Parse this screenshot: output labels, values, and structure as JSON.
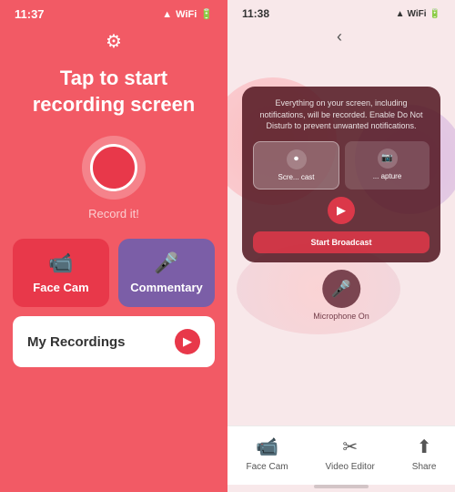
{
  "leftPanel": {
    "statusBar": {
      "time": "11:37",
      "icons": "▲ WiFi 🔋"
    },
    "settingsIcon": "⚙",
    "title": "Tap to start\nrecording screen",
    "recordLabel": "Record it!",
    "faceCamButton": {
      "label": "Face Cam",
      "icon": "📹"
    },
    "commentaryButton": {
      "label": "Commentary",
      "icon": "🎤"
    },
    "recordingsBar": {
      "label": "My Recordings",
      "arrowIcon": "▶"
    }
  },
  "rightPanel": {
    "statusBar": {
      "time": "11:38",
      "icons": "▲ WiFi 🔋"
    },
    "backIcon": "‹",
    "broadcastPopup": {
      "description": "Everything on your screen, including notifications, will be recorded. Enable Do Not Disturb to prevent unwanted notifications.",
      "option1": {
        "label": "Scre... cast",
        "icon": "⏺"
      },
      "option2": {
        "label": "... apture",
        "icon": "📷"
      },
      "startBroadcastLabel": "Start Broadcast"
    },
    "micLabel": "Microphone\nOn",
    "bottomNav": {
      "items": [
        {
          "label": "Face Cam",
          "icon": "📹"
        },
        {
          "label": "Video Editor",
          "icon": "✂"
        },
        {
          "label": "Share",
          "icon": "↑"
        }
      ]
    }
  }
}
